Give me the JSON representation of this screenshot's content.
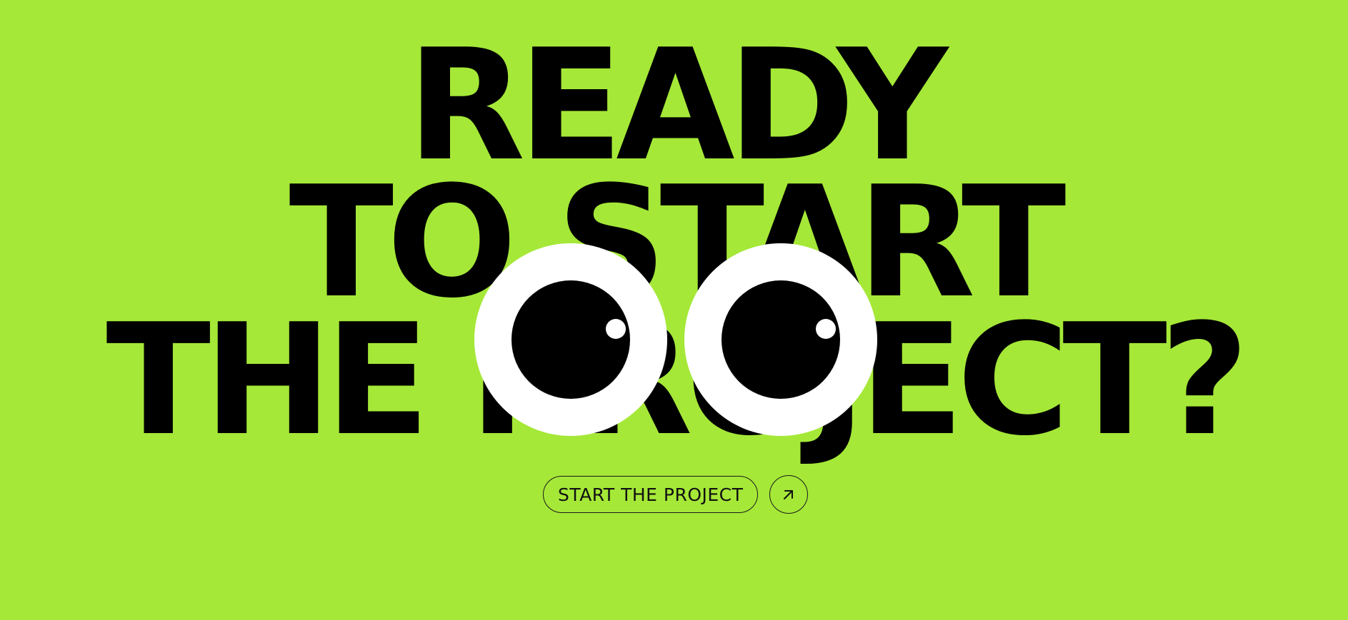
{
  "headline": {
    "line1": "READY",
    "line2": "TO START",
    "line3": "THE PROJECT?"
  },
  "cta": {
    "label": "START THE PROJECT",
    "arrow_icon": "arrow-up-right-icon"
  },
  "colors": {
    "background": "#a5e838",
    "text": "#000000",
    "eye_white": "#ffffff",
    "pupil": "#000000"
  }
}
